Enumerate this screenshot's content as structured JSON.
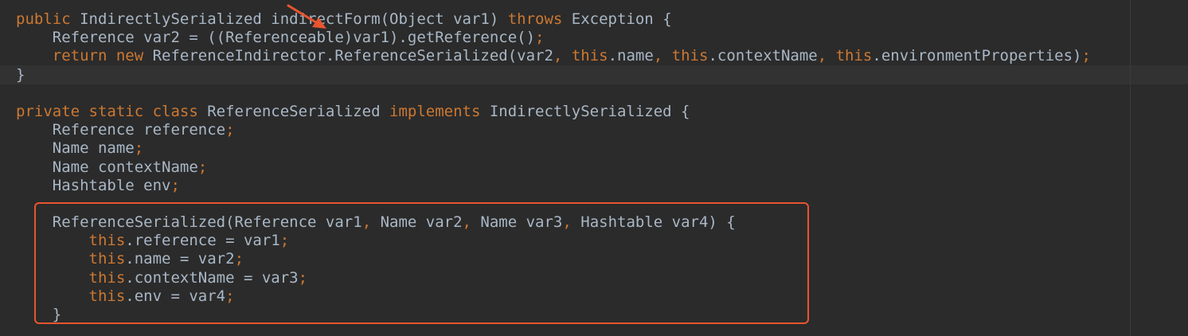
{
  "colors": {
    "background": "#2b2b2b",
    "text": "#a9b7c6",
    "keyword": "#cc7832",
    "annotation": "#e8552f"
  },
  "code": {
    "lines": [
      {
        "tokens": [
          {
            "t": "public",
            "k": "kw"
          },
          {
            "t": " IndirectlySerialized indirectForm(Object var1) ",
            "k": "txt"
          },
          {
            "t": "throws",
            "k": "kw"
          },
          {
            "t": " Exception {",
            "k": "txt"
          }
        ]
      },
      {
        "tokens": [
          {
            "t": "    Reference var2 = ((Referenceable)var1).getReference()",
            "k": "txt"
          },
          {
            "t": ";",
            "k": "punc"
          }
        ]
      },
      {
        "tokens": [
          {
            "t": "    ",
            "k": "txt"
          },
          {
            "t": "return new",
            "k": "kw"
          },
          {
            "t": " ReferenceIndirector.ReferenceSerialized(var2",
            "k": "txt"
          },
          {
            "t": ", ",
            "k": "punc"
          },
          {
            "t": "this",
            "k": "kw"
          },
          {
            "t": ".name",
            "k": "txt"
          },
          {
            "t": ", ",
            "k": "punc"
          },
          {
            "t": "this",
            "k": "kw"
          },
          {
            "t": ".contextName",
            "k": "txt"
          },
          {
            "t": ", ",
            "k": "punc"
          },
          {
            "t": "this",
            "k": "kw"
          },
          {
            "t": ".environmentProperties)",
            "k": "txt"
          },
          {
            "t": ";",
            "k": "punc"
          }
        ]
      },
      {
        "tokens": [
          {
            "t": "}",
            "k": "txt"
          }
        ]
      },
      {
        "tokens": [
          {
            "t": "",
            "k": "txt"
          }
        ]
      },
      {
        "tokens": [
          {
            "t": "private static class",
            "k": "kw"
          },
          {
            "t": " ReferenceSerialized ",
            "k": "txt"
          },
          {
            "t": "implements",
            "k": "kw"
          },
          {
            "t": " IndirectlySerialized {",
            "k": "txt"
          }
        ]
      },
      {
        "tokens": [
          {
            "t": "    Reference reference",
            "k": "txt"
          },
          {
            "t": ";",
            "k": "punc"
          }
        ]
      },
      {
        "tokens": [
          {
            "t": "    Name name",
            "k": "txt"
          },
          {
            "t": ";",
            "k": "punc"
          }
        ]
      },
      {
        "tokens": [
          {
            "t": "    Name contextName",
            "k": "txt"
          },
          {
            "t": ";",
            "k": "punc"
          }
        ]
      },
      {
        "tokens": [
          {
            "t": "    Hashtable env",
            "k": "txt"
          },
          {
            "t": ";",
            "k": "punc"
          }
        ]
      },
      {
        "tokens": [
          {
            "t": "",
            "k": "txt"
          }
        ]
      },
      {
        "tokens": [
          {
            "t": "    ReferenceSerialized(Reference var1",
            "k": "txt"
          },
          {
            "t": ", ",
            "k": "punc"
          },
          {
            "t": "Name var2",
            "k": "txt"
          },
          {
            "t": ", ",
            "k": "punc"
          },
          {
            "t": "Name var3",
            "k": "txt"
          },
          {
            "t": ", ",
            "k": "punc"
          },
          {
            "t": "Hashtable var4) {",
            "k": "txt"
          }
        ]
      },
      {
        "tokens": [
          {
            "t": "        ",
            "k": "txt"
          },
          {
            "t": "this",
            "k": "kw"
          },
          {
            "t": ".reference = var1",
            "k": "txt"
          },
          {
            "t": ";",
            "k": "punc"
          }
        ]
      },
      {
        "tokens": [
          {
            "t": "        ",
            "k": "txt"
          },
          {
            "t": "this",
            "k": "kw"
          },
          {
            "t": ".name = var2",
            "k": "txt"
          },
          {
            "t": ";",
            "k": "punc"
          }
        ]
      },
      {
        "tokens": [
          {
            "t": "        ",
            "k": "txt"
          },
          {
            "t": "this",
            "k": "kw"
          },
          {
            "t": ".contextName = var3",
            "k": "txt"
          },
          {
            "t": ";",
            "k": "punc"
          }
        ]
      },
      {
        "tokens": [
          {
            "t": "        ",
            "k": "txt"
          },
          {
            "t": "this",
            "k": "kw"
          },
          {
            "t": ".env = var4",
            "k": "txt"
          },
          {
            "t": ";",
            "k": "punc"
          }
        ]
      },
      {
        "tokens": [
          {
            "t": "    }",
            "k": "txt"
          }
        ]
      }
    ]
  }
}
